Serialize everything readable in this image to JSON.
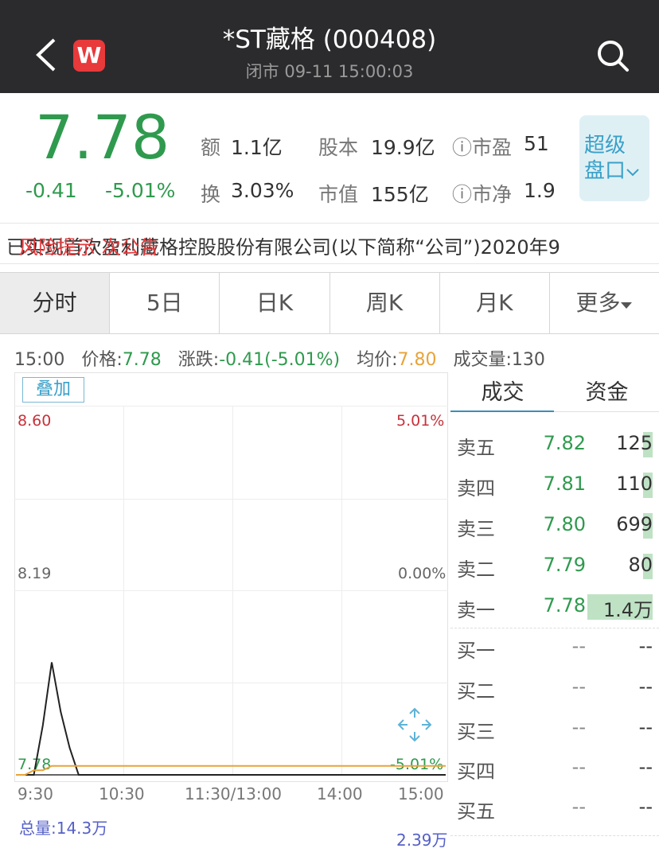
{
  "header": {
    "title": "*ST藏格 (000408)",
    "status": "闭市 09-11 15:00:03",
    "logo_letter": "W"
  },
  "quote": {
    "price": "7.78",
    "change": "-0.41",
    "change_pct": "-5.01%",
    "stats": [
      {
        "label": "额",
        "value": "1.1亿"
      },
      {
        "label": "股本",
        "value": "19.9亿"
      },
      {
        "label": "ⓘ市盈",
        "value": "51"
      },
      {
        "label": "换",
        "value": "3.03%"
      },
      {
        "label": "市值",
        "value": "155亿"
      },
      {
        "label": "ⓘ市净",
        "value": "1.9"
      }
    ],
    "super_button": [
      "超级",
      "盘口"
    ]
  },
  "ticker": {
    "text": "已实现首次盈利藏格控股股份有限公司(以下简称“公司”)2020年9",
    "overlay": "风险提示 次公告"
  },
  "tabs": [
    "分时",
    "5日",
    "日K",
    "周K",
    "月K",
    "更多"
  ],
  "info_line": {
    "time": "15:00",
    "price_label": "价格:",
    "price": "7.78",
    "change_label": "涨跌:",
    "change": "-0.41(-5.01%)",
    "avg_label": "均价:",
    "avg": "7.80",
    "vol_label": "成交量:",
    "vol": "130"
  },
  "chart": {
    "overlay_button": "叠加",
    "y_labels_left": [
      "8.60",
      "8.19",
      "7.78"
    ],
    "y_labels_right": [
      "5.01%",
      "0.00%",
      "-5.01%"
    ],
    "x_labels": [
      "9:30",
      "10:30",
      "11:30/13:00",
      "14:00",
      "15:00"
    ],
    "total_volume": "总量:14.3万",
    "max_volume": "2.39万"
  },
  "chart_data": {
    "type": "line",
    "title": "",
    "xlabel": "",
    "ylabel": "",
    "ylim": [
      7.78,
      8.6
    ],
    "x": [
      "9:30",
      "9:35",
      "9:40",
      "9:45",
      "9:50",
      "9:55",
      "10:00",
      "10:05",
      "10:10",
      "10:30",
      "11:30/13:00",
      "14:00",
      "15:00"
    ],
    "series": [
      {
        "values": [
          7.78,
          7.78,
          7.78,
          7.89,
          8.03,
          7.92,
          7.84,
          7.78,
          7.78,
          7.78,
          7.78,
          7.78,
          7.78
        ]
      },
      {
        "values": [
          7.78,
          7.78,
          7.79,
          7.79,
          7.8,
          7.8,
          7.8,
          7.8,
          7.8,
          7.8,
          7.8,
          7.8,
          7.8
        ]
      }
    ],
    "colors": {
      "price": "#222222",
      "average": "#e8a33a"
    }
  },
  "order_book": {
    "tabs": [
      "成交",
      "资金"
    ],
    "rows": [
      {
        "label": "卖五",
        "price": "7.82",
        "volume": "125",
        "bar": 0.02
      },
      {
        "label": "卖四",
        "price": "7.81",
        "volume": "110",
        "bar": 0.02
      },
      {
        "label": "卖三",
        "price": "7.80",
        "volume": "699",
        "bar": 0.06
      },
      {
        "label": "卖二",
        "price": "7.79",
        "volume": "80",
        "bar": 0.02
      },
      {
        "label": "卖一",
        "price": "7.78",
        "volume": "1.4万",
        "bar": 1.0
      },
      {
        "label": "买一",
        "price": "--",
        "volume": "--",
        "bar": 0
      },
      {
        "label": "买二",
        "price": "--",
        "volume": "--",
        "bar": 0
      },
      {
        "label": "买三",
        "price": "--",
        "volume": "--",
        "bar": 0
      },
      {
        "label": "买四",
        "price": "--",
        "volume": "--",
        "bar": 0
      },
      {
        "label": "买五",
        "price": "--",
        "volume": "--",
        "bar": 0
      }
    ]
  },
  "colors": {
    "header_bg": "#2b2b2d",
    "down_green": "#2f9a4e",
    "up_red": "#c9313a",
    "accent_blue": "#3aa0c8",
    "average_orange": "#e8a33a"
  }
}
